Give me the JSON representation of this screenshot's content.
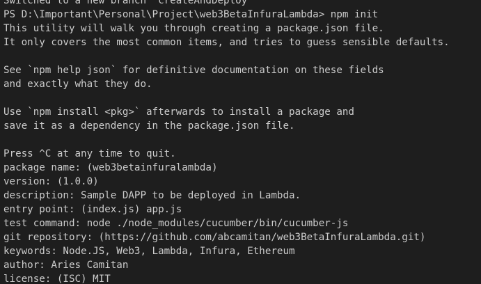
{
  "terminal": {
    "lines": [
      "Switched to a new branch 'createAndDeploy'",
      "PS D:\\Important\\Personal\\Project\\web3BetaInfuraLambda> npm init",
      "This utility will walk you through creating a package.json file.",
      "It only covers the most common items, and tries to guess sensible defaults.",
      "",
      "See `npm help json` for definitive documentation on these fields",
      "and exactly what they do.",
      "",
      "Use `npm install <pkg>` afterwards to install a package and",
      "save it as a dependency in the package.json file.",
      "",
      "Press ^C at any time to quit.",
      "package name: (web3betainfuralambda)",
      "version: (1.0.0)",
      "description: Sample DAPP to be deployed in Lambda.",
      "entry point: (index.js) app.js",
      "test command: node ./node_modules/cucumber/bin/cucumber-js",
      "git repository: (https://github.com/abcamitan/web3BetaInfuraLambda.git)",
      "keywords: Node.JS, Web3, Lambda, Infura, Ethereum",
      "author: Aries Camitan",
      "license: (ISC) MIT"
    ],
    "colors": {
      "background": "#1e1e1e",
      "foreground": "#cccccc"
    }
  }
}
